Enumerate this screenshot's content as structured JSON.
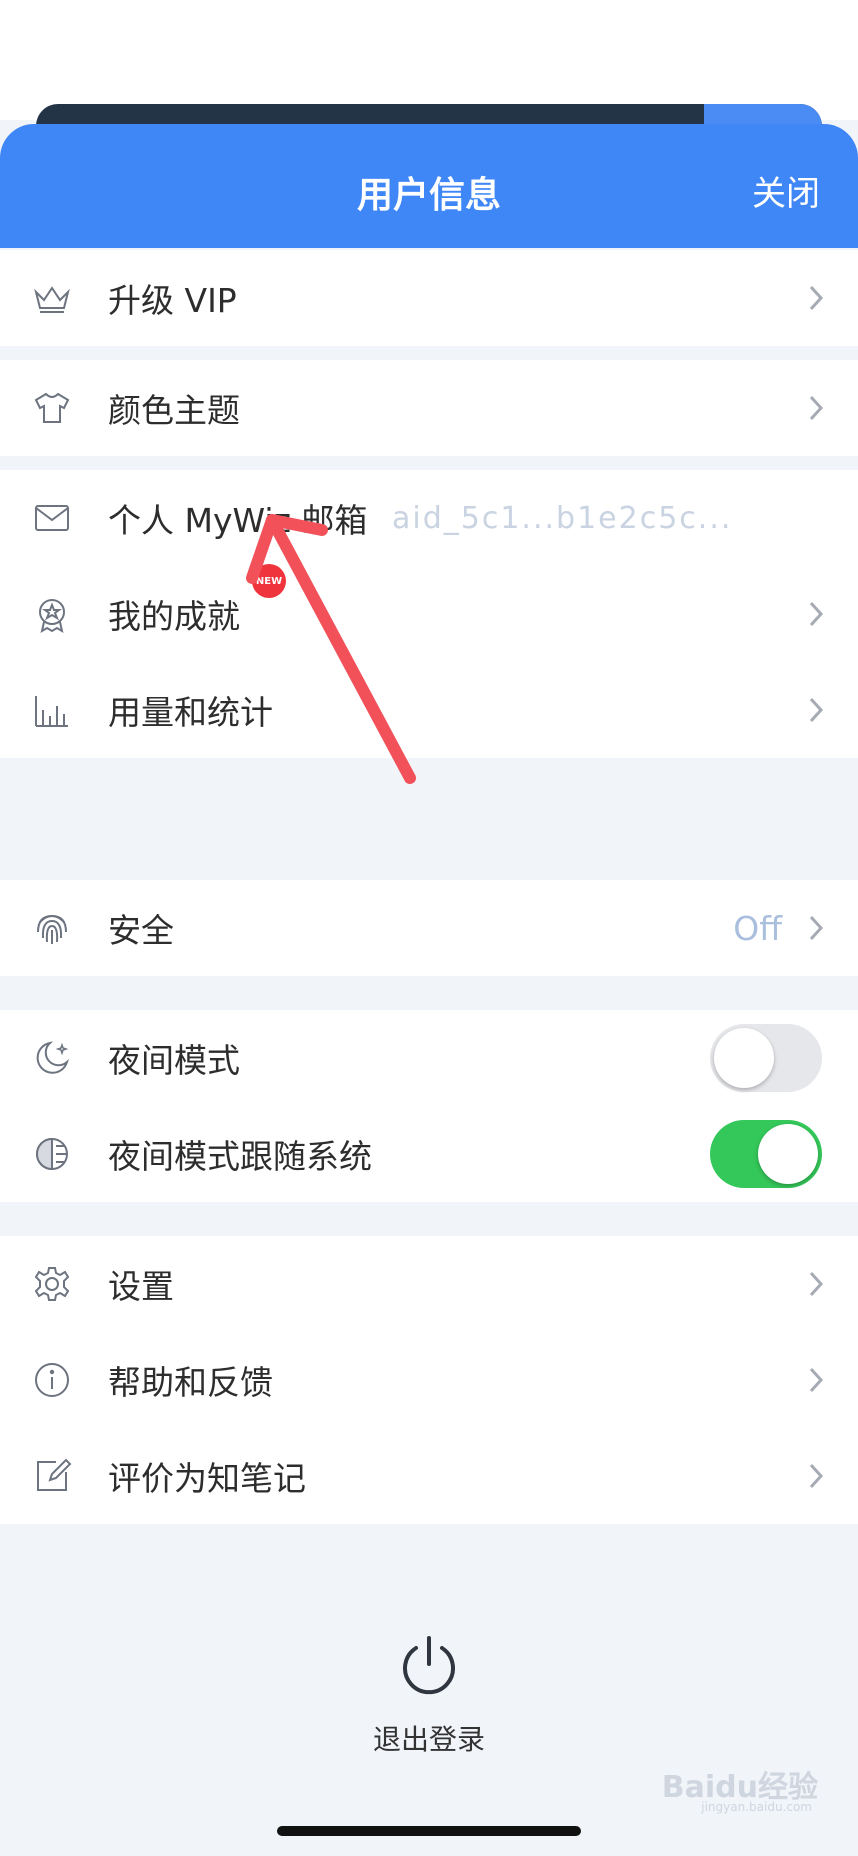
{
  "header": {
    "title": "用户信息",
    "close_label": "关闭"
  },
  "groups": {
    "vip": {
      "label": "升级 VIP",
      "icon": "crown-icon"
    },
    "theme": {
      "label": "颜色主题",
      "icon": "shirt-icon"
    },
    "account": {
      "email": {
        "label": "个人 MyWiz 邮箱",
        "value": "aid_5c1...b1e2c5c...",
        "icon": "mail-icon"
      },
      "achievements": {
        "label": "我的成就",
        "badge": "NEW",
        "icon": "award-icon"
      },
      "usage": {
        "label": "用量和统计",
        "icon": "bar-chart-icon"
      }
    },
    "security": {
      "label": "安全",
      "value": "Off",
      "icon": "fingerprint-icon"
    },
    "night": {
      "night_mode": {
        "label": "夜间模式",
        "enabled": false,
        "icon": "moon-icon"
      },
      "follow_system": {
        "label": "夜间模式跟随系统",
        "enabled": true,
        "icon": "half-circle-icon"
      }
    },
    "misc": {
      "settings": {
        "label": "设置",
        "icon": "gear-icon"
      },
      "help": {
        "label": "帮助和反馈",
        "icon": "info-icon"
      },
      "rate": {
        "label": "评价为知笔记",
        "icon": "edit-icon"
      }
    }
  },
  "logout": {
    "label": "退出登录",
    "icon": "power-icon"
  },
  "watermark": {
    "text": "Baidu经验",
    "sub": "jingyan.baidu.com"
  },
  "colors": {
    "header_blue": "#3f86f6",
    "toggle_on": "#34c759",
    "arrow_red": "#f2515a"
  }
}
